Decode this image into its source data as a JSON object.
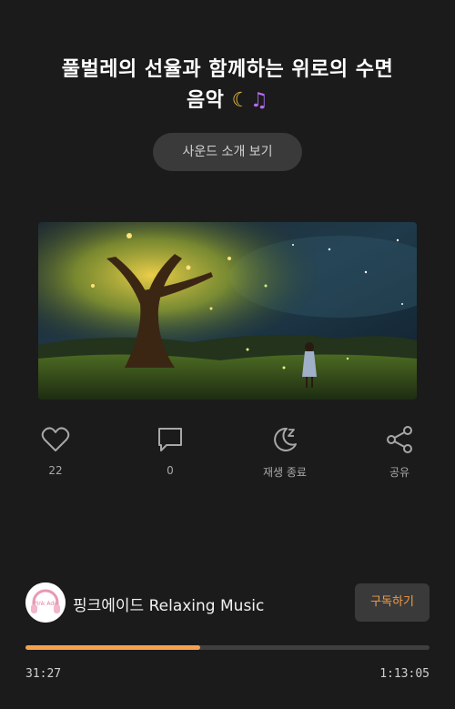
{
  "title": {
    "line1": "풀벌레의 선율과 함께하는 위로의 수면",
    "line2": "음악",
    "emoji": [
      "crescent-moon",
      "musical-notes"
    ]
  },
  "sound_intro_button": "사운드 소개 보기",
  "actions": {
    "like_count": "22",
    "comment_count": "0",
    "sleep_timer_label": "재생 종료",
    "share_label": "공유"
  },
  "channel": {
    "name": "핑크에이드 Relaxing Music",
    "subscribe_label": "구독하기",
    "avatar_text": "Pink Ade"
  },
  "player": {
    "progress": 0.432,
    "current_time": "31:27",
    "total_time": "1:13:05"
  },
  "colors": {
    "background": "#1b1b1b",
    "accent": "#f4a14e",
    "button_bg": "#3a3a3a"
  }
}
